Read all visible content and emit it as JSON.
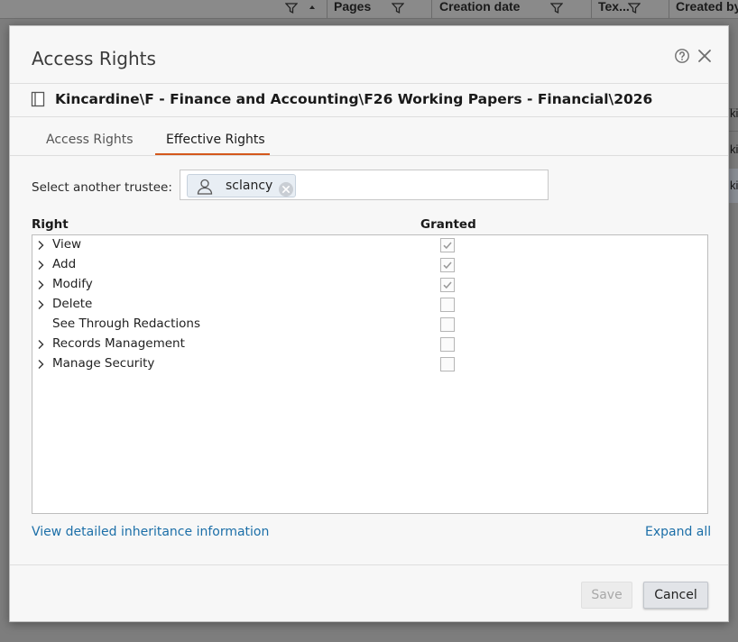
{
  "background_grid": {
    "columns": [
      {
        "label": "Pages"
      },
      {
        "label": "Creation date"
      },
      {
        "label": "Tex..."
      },
      {
        "label": "Created by"
      }
    ],
    "row_fragment": "ki"
  },
  "dialog": {
    "title": "Access Rights",
    "help_icon": "question-circle-icon",
    "close_icon": "close-icon",
    "path": "Kincardine\\F - Finance and Accounting\\F26 Working Papers - Financial\\2026",
    "tabs": [
      {
        "label": "Access Rights",
        "active": false
      },
      {
        "label": "Effective Rights",
        "active": true
      }
    ],
    "trustee": {
      "label": "Select another trustee:",
      "selected": "sclancy"
    },
    "columns": {
      "right": "Right",
      "granted": "Granted"
    },
    "rights": [
      {
        "label": "View",
        "expandable": true,
        "granted": true
      },
      {
        "label": "Add",
        "expandable": true,
        "granted": true
      },
      {
        "label": "Modify",
        "expandable": true,
        "granted": true
      },
      {
        "label": "Delete",
        "expandable": true,
        "granted": false
      },
      {
        "label": "See Through Redactions",
        "expandable": false,
        "granted": false
      },
      {
        "label": "Records Management",
        "expandable": true,
        "granted": false
      },
      {
        "label": "Manage Security",
        "expandable": true,
        "granted": false
      }
    ],
    "links": {
      "inheritance": "View detailed inheritance information",
      "expand_all": "Expand all"
    },
    "buttons": {
      "save": "Save",
      "cancel": "Cancel"
    },
    "colors": {
      "accent_tab": "#d4581c",
      "link": "#1c6fa8"
    }
  }
}
